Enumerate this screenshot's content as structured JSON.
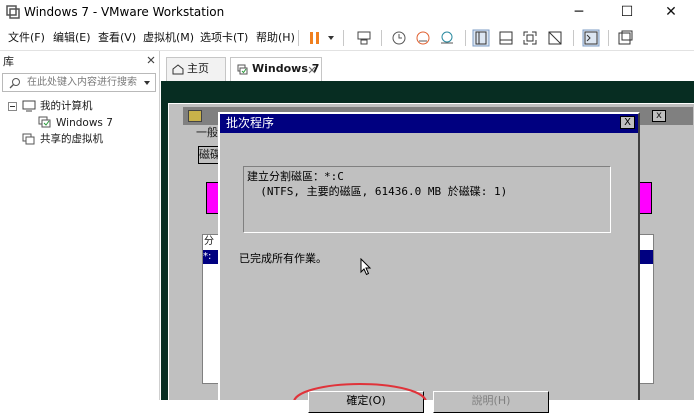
{
  "window": {
    "title": "Windows 7 - VMware Workstation",
    "min": "─",
    "max": "☐",
    "close": "✕"
  },
  "menu": {
    "items": [
      "文件(F)",
      "编辑(E)",
      "查看(V)",
      "虚拟机(M)",
      "选项卡(T)",
      "帮助(H)"
    ]
  },
  "library": {
    "title": "库",
    "search_placeholder": "在此处键入内容进行搜索",
    "my_computer": "我的计算机",
    "vm_name": "Windows 7",
    "shared": "共享的虚拟机"
  },
  "tabs": [
    {
      "label": "主页"
    },
    {
      "label": "Windows 7"
    }
  ],
  "vm": {
    "under_label_general": "一般",
    "under_label_disk": "磁碟",
    "under_col": "分",
    "under_row": "*:"
  },
  "dialog": {
    "title": "批次程序",
    "close": "X",
    "log_line1": "建立分割磁區：*:C",
    "log_line2": "  (NTFS, 主要的磁區, 61436.0 MB 於磁碟: 1)",
    "status": "已完成所有作業。",
    "ok_button": "確定(O)",
    "other_button": "說明(H)"
  },
  "colors": {
    "dialog_title_bg": "#000080",
    "vm_bg": "#072d22",
    "accent_pause": "#f07f1e",
    "highlight_circle": "#e0333a",
    "pink_bar": "#ff00ff"
  }
}
